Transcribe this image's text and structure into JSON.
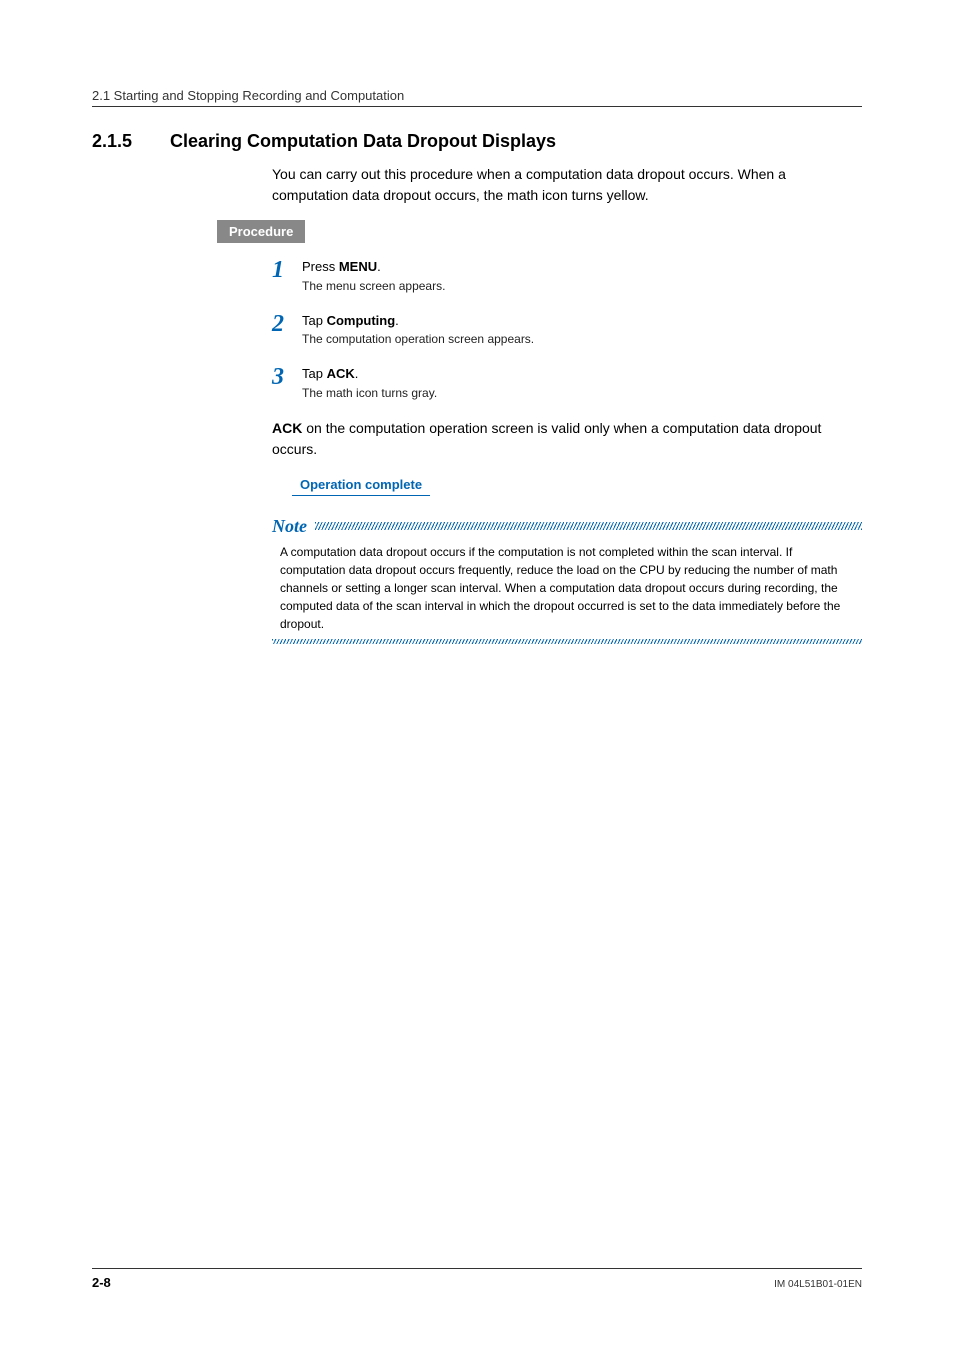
{
  "header": {
    "breadcrumb": "2.1  Starting and Stopping Recording and Computation"
  },
  "section": {
    "number": "2.1.5",
    "title": "Clearing Computation Data Dropout Displays",
    "intro": "You can carry out this procedure when a computation data dropout occurs. When a computation data dropout occurs, the math icon turns yellow."
  },
  "procedure_label": "Procedure",
  "steps": [
    {
      "num": "1",
      "action_prefix": "Press ",
      "action_bold": "MENU",
      "action_suffix": ".",
      "result": "The menu screen appears."
    },
    {
      "num": "2",
      "action_prefix": "Tap ",
      "action_bold": "Computing",
      "action_suffix": ".",
      "result": "The computation operation screen appears."
    },
    {
      "num": "3",
      "action_prefix": "Tap ",
      "action_bold": "ACK",
      "action_suffix": ".",
      "result": "The math icon turns gray."
    }
  ],
  "ack_note": {
    "bold": "ACK",
    "rest": " on the computation operation screen is valid only when a computation data dropout occurs."
  },
  "operation_complete": "Operation complete",
  "note": {
    "label": "Note",
    "body": "A computation data dropout occurs if the computation is not completed within the scan interval. If computation data dropout occurs frequently, reduce the load on the CPU by reducing the number of math channels or setting a longer scan interval. When a computation data dropout occurs during recording, the computed data of the scan interval in which the dropout occurred is set to the data immediately before the dropout."
  },
  "footer": {
    "page": "2-8",
    "doc_id": "IM 04L51B01-01EN"
  }
}
